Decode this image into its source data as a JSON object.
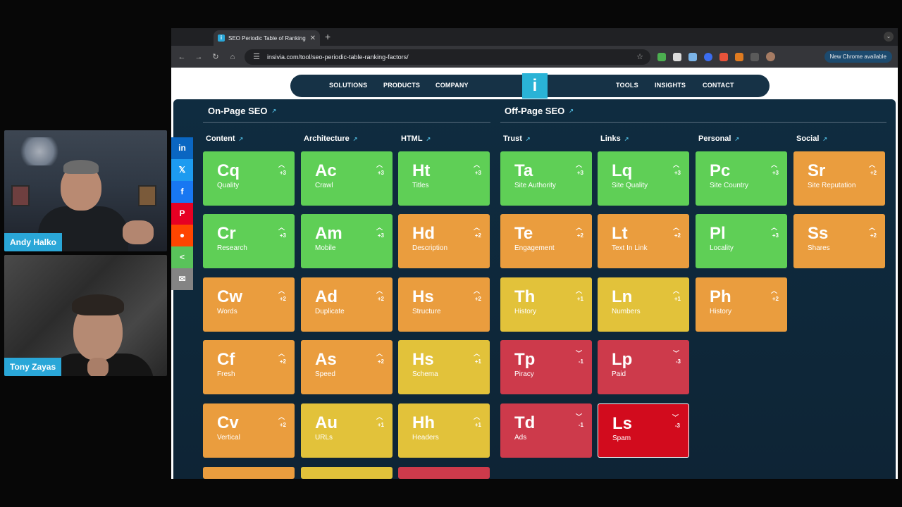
{
  "participants": [
    {
      "name": "Andy Halko"
    },
    {
      "name": "Tony Zayas"
    }
  ],
  "browser": {
    "tab_title": "SEO Periodic Table of Ranking",
    "tab_favicon": "i",
    "tab_close": "✕",
    "new_tab": "+",
    "url": "insivia.com/tool/seo-periodic-table-ranking-factors/",
    "update_button": "New Chrome available"
  },
  "site_nav": {
    "left": [
      "SOLUTIONS",
      "PRODUCTS",
      "COMPANY"
    ],
    "logo": "i",
    "right": [
      "TOOLS",
      "INSIGHTS",
      "CONTACT"
    ]
  },
  "sections": {
    "on_page": "On-Page SEO",
    "off_page": "Off-Page SEO"
  },
  "categories": [
    "Content",
    "Architecture",
    "HTML",
    "Trust",
    "Links",
    "Personal",
    "Social"
  ],
  "tiles": [
    {
      "sym": "Cq",
      "label": "Quality",
      "weight": "+3",
      "dir": "^",
      "color": "green",
      "col": 0,
      "row": 0
    },
    {
      "sym": "Ac",
      "label": "Crawl",
      "weight": "+3",
      "dir": "^",
      "color": "green",
      "col": 1,
      "row": 0
    },
    {
      "sym": "Ht",
      "label": "Titles",
      "weight": "+3",
      "dir": "^",
      "color": "green",
      "col": 2,
      "row": 0
    },
    {
      "sym": "Ta",
      "label": "Site Authority",
      "weight": "+3",
      "dir": "^",
      "color": "green",
      "col": 3,
      "row": 0
    },
    {
      "sym": "Lq",
      "label": "Site Quality",
      "weight": "+3",
      "dir": "^",
      "color": "green",
      "col": 4,
      "row": 0
    },
    {
      "sym": "Pc",
      "label": "Site Country",
      "weight": "+3",
      "dir": "^",
      "color": "green",
      "col": 5,
      "row": 0
    },
    {
      "sym": "Sr",
      "label": "Site Reputation",
      "weight": "+2",
      "dir": "^",
      "color": "orange",
      "col": 6,
      "row": 0
    },
    {
      "sym": "Cr",
      "label": "Research",
      "weight": "+3",
      "dir": "^",
      "color": "green",
      "col": 0,
      "row": 1
    },
    {
      "sym": "Am",
      "label": "Mobile",
      "weight": "+3",
      "dir": "^",
      "color": "green",
      "col": 1,
      "row": 1
    },
    {
      "sym": "Hd",
      "label": "Description",
      "weight": "+2",
      "dir": "^",
      "color": "orange",
      "col": 2,
      "row": 1
    },
    {
      "sym": "Te",
      "label": "Engagement",
      "weight": "+2",
      "dir": "^",
      "color": "orange",
      "col": 3,
      "row": 1
    },
    {
      "sym": "Lt",
      "label": "Text In Link",
      "weight": "+2",
      "dir": "^",
      "color": "orange",
      "col": 4,
      "row": 1
    },
    {
      "sym": "Pl",
      "label": "Locality",
      "weight": "+3",
      "dir": "^",
      "color": "green",
      "col": 5,
      "row": 1
    },
    {
      "sym": "Ss",
      "label": "Shares",
      "weight": "+2",
      "dir": "^",
      "color": "orange",
      "col": 6,
      "row": 1
    },
    {
      "sym": "Cw",
      "label": "Words",
      "weight": "+2",
      "dir": "^",
      "color": "orange",
      "col": 0,
      "row": 2
    },
    {
      "sym": "Ad",
      "label": "Duplicate",
      "weight": "+2",
      "dir": "^",
      "color": "orange",
      "col": 1,
      "row": 2
    },
    {
      "sym": "Hs",
      "label": "Structure",
      "weight": "+2",
      "dir": "^",
      "color": "orange",
      "col": 2,
      "row": 2
    },
    {
      "sym": "Th",
      "label": "History",
      "weight": "+1",
      "dir": "^",
      "color": "yellow",
      "col": 3,
      "row": 2
    },
    {
      "sym": "Ln",
      "label": "Numbers",
      "weight": "+1",
      "dir": "^",
      "color": "yellow",
      "col": 4,
      "row": 2
    },
    {
      "sym": "Ph",
      "label": "History",
      "weight": "+2",
      "dir": "^",
      "color": "orange",
      "col": 5,
      "row": 2
    },
    {
      "sym": "Cf",
      "label": "Fresh",
      "weight": "+2",
      "dir": "^",
      "color": "orange",
      "col": 0,
      "row": 3
    },
    {
      "sym": "As",
      "label": "Speed",
      "weight": "+2",
      "dir": "^",
      "color": "orange",
      "col": 1,
      "row": 3
    },
    {
      "sym": "Hs",
      "label": "Schema",
      "weight": "+1",
      "dir": "^",
      "color": "yellow",
      "col": 2,
      "row": 3
    },
    {
      "sym": "Tp",
      "label": "Piracy",
      "weight": "-1",
      "dir": "v",
      "color": "red",
      "col": 3,
      "row": 3
    },
    {
      "sym": "Lp",
      "label": "Paid",
      "weight": "-3",
      "dir": "v",
      "color": "red",
      "col": 4,
      "row": 3
    },
    {
      "sym": "Cv",
      "label": "Vertical",
      "weight": "+2",
      "dir": "^",
      "color": "orange",
      "col": 0,
      "row": 4
    },
    {
      "sym": "Au",
      "label": "URLs",
      "weight": "+1",
      "dir": "^",
      "color": "yellow",
      "col": 1,
      "row": 4
    },
    {
      "sym": "Hh",
      "label": "Headers",
      "weight": "+1",
      "dir": "^",
      "color": "yellow",
      "col": 2,
      "row": 4
    },
    {
      "sym": "Td",
      "label": "Ads",
      "weight": "-1",
      "dir": "v",
      "color": "red",
      "col": 3,
      "row": 4
    },
    {
      "sym": "Ls",
      "label": "Spam",
      "weight": "-3",
      "dir": "v",
      "color": "darkred",
      "col": 4,
      "row": 4
    }
  ],
  "partial_row_colors": [
    "orange",
    "yellow",
    "red"
  ],
  "share_buttons": [
    {
      "icon": "linkedin-icon",
      "glyph": "in",
      "color": "#0a66c2"
    },
    {
      "icon": "x-icon",
      "glyph": "𝕏",
      "color": "#1d9bf0"
    },
    {
      "icon": "facebook-icon",
      "glyph": "f",
      "color": "#1877f2"
    },
    {
      "icon": "pinterest-icon",
      "glyph": "P",
      "color": "#e60023"
    },
    {
      "icon": "reddit-icon",
      "glyph": "●",
      "color": "#ff4500"
    },
    {
      "icon": "share-icon",
      "glyph": "<",
      "color": "#59c35a"
    },
    {
      "icon": "email-icon",
      "glyph": "✉",
      "color": "#848484"
    }
  ]
}
